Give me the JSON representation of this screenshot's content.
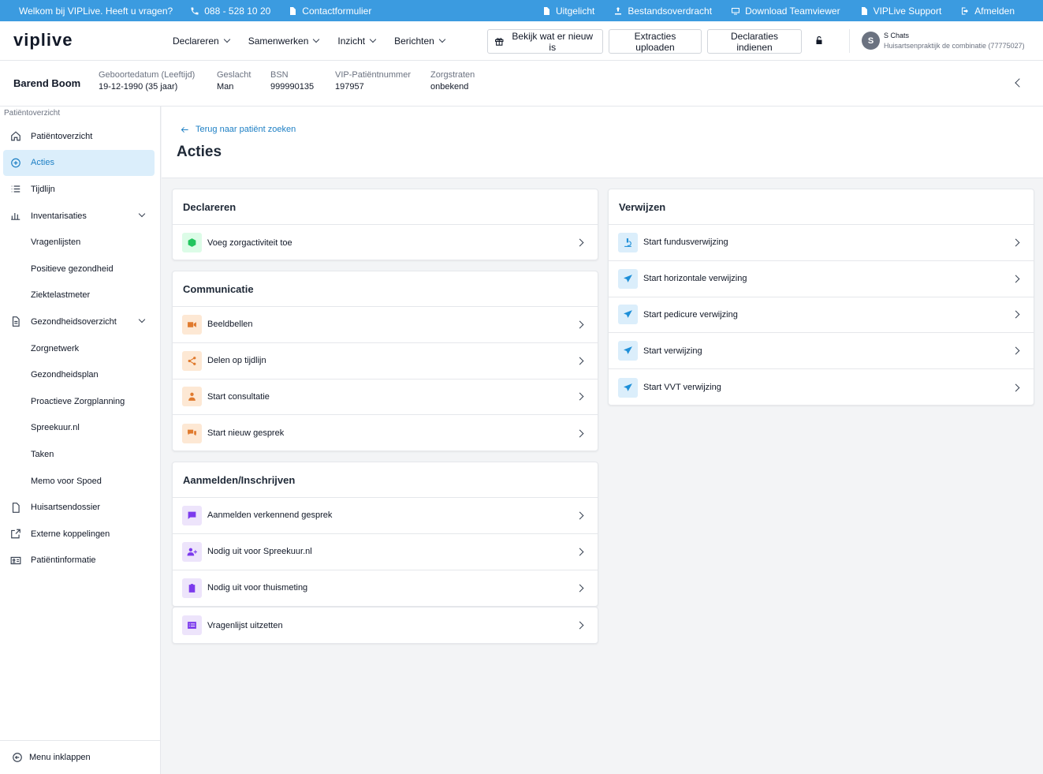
{
  "topbar": {
    "welcome": "Welkom bij VIPLive. Heeft u vragen?",
    "phone": "088 - 528 10 20",
    "contact": "Contactformulier",
    "links": [
      "Uitgelicht",
      "Bestandsoverdracht",
      "Download Teamviewer",
      "VIPLive Support",
      "Afmelden"
    ]
  },
  "header": {
    "logo": "viplive",
    "nav": [
      "Declareren",
      "Samenwerken",
      "Inzicht",
      "Berichten"
    ],
    "btn_new": "Bekijk wat er nieuw is",
    "btn_extract": "Extracties uploaden",
    "btn_declare": "Declaraties indienen",
    "user_initial": "S",
    "user_name": "S Chats",
    "user_org": "Huisartsenpraktijk de combinatie (77775027)"
  },
  "patient": {
    "name": "Barend Boom",
    "fields": [
      {
        "label": "Geboortedatum (Leeftijd)",
        "value": "19-12-1990 (35 jaar)"
      },
      {
        "label": "Geslacht",
        "value": "Man"
      },
      {
        "label": "BSN",
        "value": "999990135"
      },
      {
        "label": "VIP-Patiëntnummer",
        "value": "197957"
      },
      {
        "label": "Zorgstraten",
        "value": "onbekend"
      }
    ]
  },
  "sidebar": {
    "crumb": "Patiëntoverzicht",
    "items": [
      {
        "label": "Patiëntoverzicht",
        "icon": "home-icon"
      },
      {
        "label": "Acties",
        "icon": "plus-circle-icon",
        "active": true
      },
      {
        "label": "Tijdlijn",
        "icon": "list-icon"
      },
      {
        "label": "Inventarisaties",
        "icon": "bar-chart-icon",
        "expand": true
      },
      {
        "label": "Vragenlijsten"
      },
      {
        "label": "Positieve gezondheid"
      },
      {
        "label": "Ziektelastmeter"
      },
      {
        "label": "Gezondheidsoverzicht",
        "icon": "document-icon",
        "expand": true
      },
      {
        "label": "Zorgnetwerk"
      },
      {
        "label": "Gezondheidsplan"
      },
      {
        "label": "Proactieve Zorgplanning"
      },
      {
        "label": "Spreekuur.nl"
      },
      {
        "label": "Taken"
      },
      {
        "label": "Memo voor Spoed"
      },
      {
        "label": "Huisartsendossier",
        "icon": "file-icon"
      },
      {
        "label": "Externe koppelingen",
        "icon": "external-link-icon"
      },
      {
        "label": "Patiëntinformatie",
        "icon": "id-card-icon"
      }
    ],
    "collapse": "Menu inklappen"
  },
  "main": {
    "back": "Terug naar patiënt zoeken",
    "title": "Acties",
    "cards": {
      "declareren": {
        "title": "Declareren",
        "rows": [
          "Voeg zorgactiviteit toe"
        ]
      },
      "communicatie": {
        "title": "Communicatie",
        "rows": [
          "Beeldbellen",
          "Delen op tijdlijn",
          "Start consultatie",
          "Start nieuw gesprek"
        ]
      },
      "aanmelden": {
        "title": "Aanmelden/Inschrijven",
        "rows": [
          "Aanmelden verkennend gesprek",
          "Nodig uit voor Spreekuur.nl",
          "Nodig uit voor thuismeting"
        ]
      },
      "vragenlijst": {
        "rows": [
          "Vragenlijst uitzetten"
        ]
      },
      "verwijzen": {
        "title": "Verwijzen",
        "rows": [
          "Start fundusverwijzing",
          "Start horizontale verwijzing",
          "Start pedicure verwijzing",
          "Start verwijzing",
          "Start VVT verwijzing"
        ]
      }
    }
  },
  "colors": {
    "accent": "#3b9be0",
    "link": "#1d7fc4",
    "green": "#22c55e",
    "orange": "#e07a2e",
    "purple": "#7c3aed",
    "blue": "#1d8fd8"
  }
}
